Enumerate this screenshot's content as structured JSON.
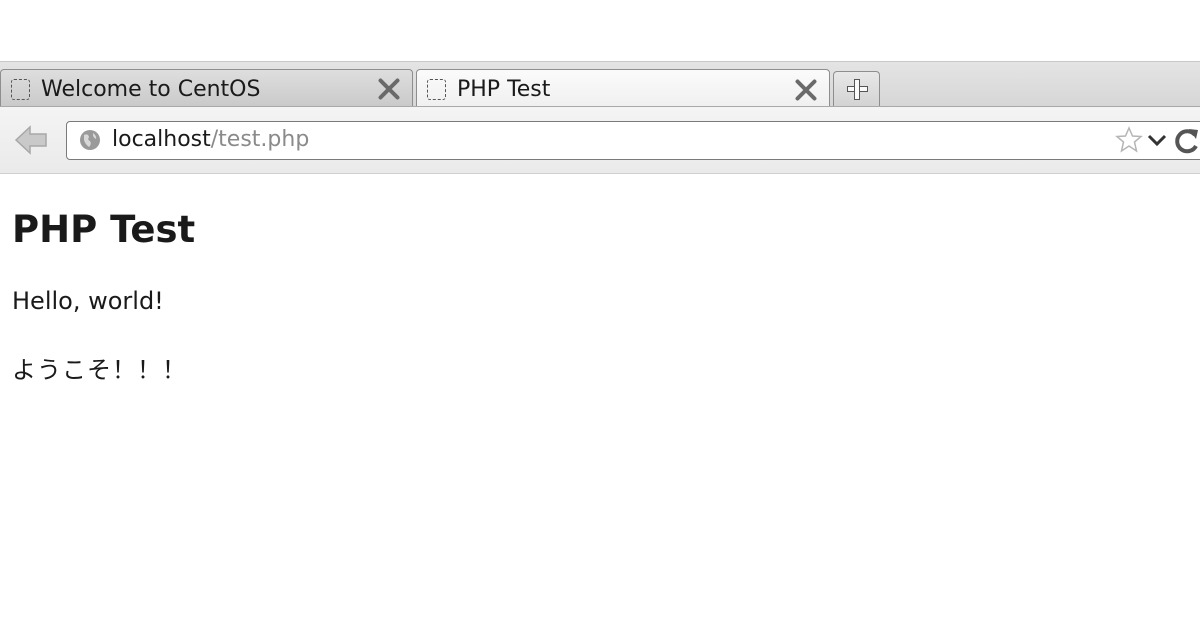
{
  "tabs": [
    {
      "title": "Welcome to CentOS",
      "active": false
    },
    {
      "title": "PHP Test",
      "active": true
    }
  ],
  "address_bar": {
    "host": "localhost",
    "path": "/test.php"
  },
  "page": {
    "heading": "PHP Test",
    "paragraphs": [
      "Hello, world!",
      "ようこそ！！！"
    ]
  },
  "icons": {
    "favicon": "blank-page-icon",
    "close": "close-icon",
    "new_tab": "plus-icon",
    "back": "back-arrow-icon",
    "site": "globe-icon",
    "bookmark": "star-icon",
    "history": "chevron-down-icon",
    "reload": "reload-icon"
  }
}
